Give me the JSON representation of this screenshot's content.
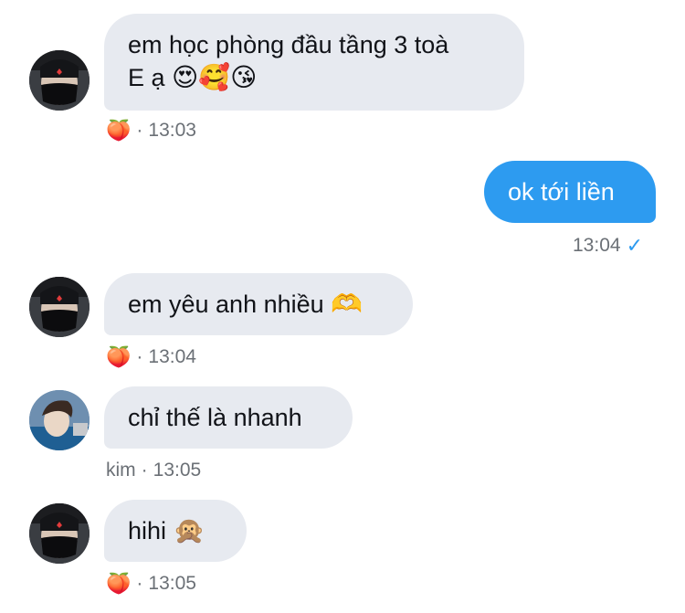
{
  "messages": [
    {
      "kind": "in",
      "avatar": "masked-user",
      "text_line1": "em học phòng đầu tầng 3 toà",
      "text_line2": "E ạ",
      "emojis": [
        "😍",
        "🥰",
        "😘"
      ],
      "reaction": "🍑",
      "time": "13:03"
    },
    {
      "kind": "out",
      "text": "ok tới liền",
      "time": "13:04",
      "status": "✓"
    },
    {
      "kind": "in",
      "avatar": "masked-user",
      "text": "em yêu anh nhiều",
      "emoji": "🫶",
      "reaction": "🍑",
      "time": "13:04"
    },
    {
      "kind": "in",
      "avatar": "kim",
      "text": "chỉ thế là nhanh",
      "sender": "kim",
      "time": "13:05"
    },
    {
      "kind": "in",
      "avatar": "masked-user",
      "text": "hihi",
      "emoji": "🙊",
      "reaction": "🍑",
      "time": "13:05"
    }
  ],
  "colors": {
    "outgoing_bubble": "#2d9bf0",
    "incoming_bubble": "#e7eaf0",
    "meta_text": "#6b7076"
  }
}
